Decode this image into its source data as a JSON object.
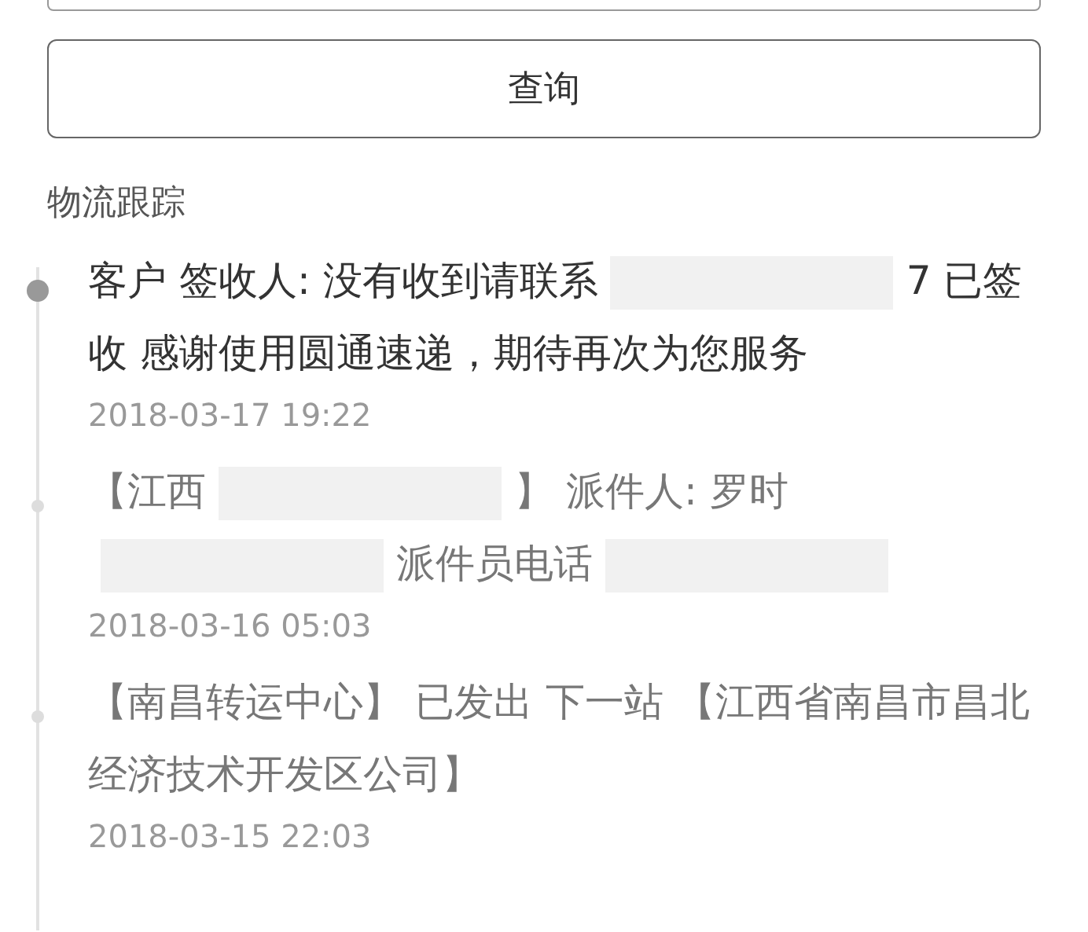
{
  "query_button": "查询",
  "section_title": "物流跟踪",
  "events": [
    {
      "latest": true,
      "parts": [
        {
          "kind": "text",
          "text": "客户 签收人: 没有收到请联系"
        },
        {
          "kind": "redaction"
        },
        {
          "kind": "text",
          "text": "7 已签收 感谢使用圆通速递，期待再次为您服务"
        }
      ],
      "time": "2018-03-17 19:22"
    },
    {
      "latest": false,
      "parts": [
        {
          "kind": "text",
          "text": "【江西"
        },
        {
          "kind": "redaction"
        },
        {
          "kind": "text",
          "text": "】 派件人: 罗时"
        },
        {
          "kind": "redaction"
        },
        {
          "kind": "text",
          "text": "派件员电话"
        },
        {
          "kind": "redaction"
        }
      ],
      "time": "2018-03-16 05:03"
    },
    {
      "latest": false,
      "parts": [
        {
          "kind": "text",
          "text": "【南昌转运中心】 已发出 下一站 【江西省南昌市昌北经济技术开发区公司】"
        }
      ],
      "time": "2018-03-15 22:03"
    }
  ]
}
